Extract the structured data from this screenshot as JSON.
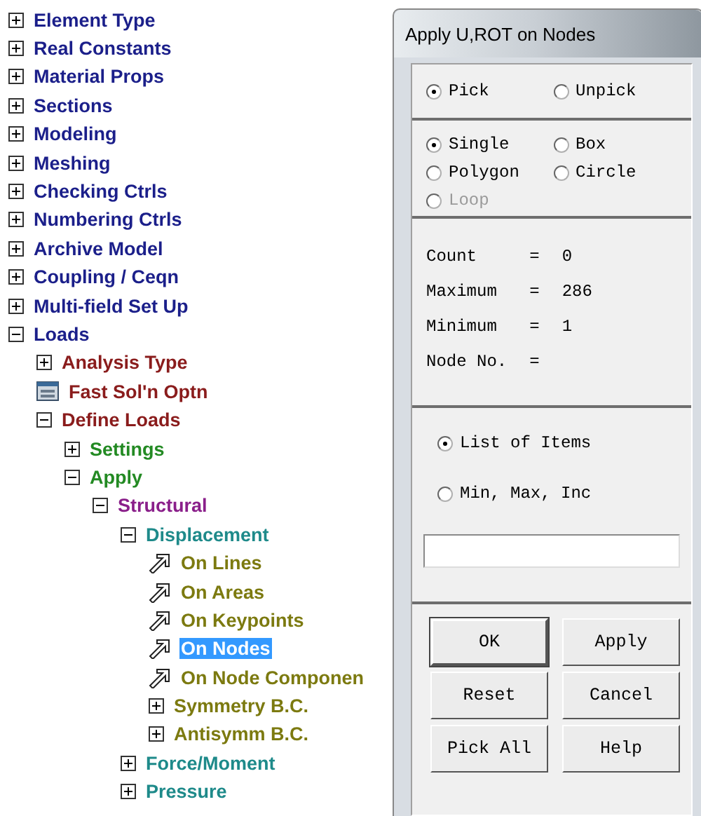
{
  "tree": [
    {
      "kind": "branch",
      "label": "Element Type",
      "expanded": false,
      "selected": false
    },
    {
      "kind": "branch",
      "label": "Real Constants",
      "expanded": false,
      "selected": false
    },
    {
      "kind": "branch",
      "label": "Material Props",
      "expanded": false,
      "selected": false
    },
    {
      "kind": "branch",
      "label": "Sections",
      "expanded": false,
      "selected": false
    },
    {
      "kind": "branch",
      "label": "Modeling",
      "expanded": false,
      "selected": false
    },
    {
      "kind": "branch",
      "label": "Meshing",
      "expanded": false,
      "selected": false
    },
    {
      "kind": "branch",
      "label": "Checking Ctrls",
      "expanded": false,
      "selected": false
    },
    {
      "kind": "branch",
      "label": "Numbering Ctrls",
      "expanded": false,
      "selected": false
    },
    {
      "kind": "branch",
      "label": "Archive Model",
      "expanded": false,
      "selected": false
    },
    {
      "kind": "branch",
      "label": "Coupling / Ceqn",
      "expanded": false,
      "selected": false
    },
    {
      "kind": "branch",
      "label": "Multi-field Set Up",
      "expanded": false,
      "selected": false
    },
    {
      "kind": "branch",
      "label": "Loads",
      "expanded": true,
      "selected": false,
      "children": [
        {
          "kind": "branch",
          "label": "Analysis Type",
          "expanded": false,
          "selected": false
        },
        {
          "kind": "dialog",
          "label": "Fast Sol'n Optn",
          "selected": false
        },
        {
          "kind": "branch",
          "label": "Define Loads",
          "expanded": true,
          "selected": false,
          "children": [
            {
              "kind": "branch",
              "label": "Settings",
              "expanded": false,
              "selected": false
            },
            {
              "kind": "branch",
              "label": "Apply",
              "expanded": true,
              "selected": false,
              "children": [
                {
                  "kind": "branch",
                  "label": "Structural",
                  "expanded": true,
                  "selected": false,
                  "children": [
                    {
                      "kind": "branch",
                      "label": "Displacement",
                      "expanded": true,
                      "selected": false,
                      "children": [
                        {
                          "kind": "action",
                          "label": "On Lines",
                          "selected": false
                        },
                        {
                          "kind": "action",
                          "label": "On Areas",
                          "selected": false
                        },
                        {
                          "kind": "action",
                          "label": "On Keypoints",
                          "selected": false
                        },
                        {
                          "kind": "action",
                          "label": "On Nodes",
                          "selected": true
                        },
                        {
                          "kind": "action",
                          "label": "On Node Componen",
                          "selected": false
                        },
                        {
                          "kind": "branch",
                          "label": "Symmetry B.C.",
                          "expanded": false,
                          "selected": false
                        },
                        {
                          "kind": "branch",
                          "label": "Antisymm B.C.",
                          "expanded": false,
                          "selected": false
                        }
                      ]
                    },
                    {
                      "kind": "branch",
                      "label": "Force/Moment",
                      "expanded": false,
                      "selected": false
                    },
                    {
                      "kind": "branch",
                      "label": "Pressure",
                      "expanded": false,
                      "selected": false
                    }
                  ]
                }
              ]
            }
          ]
        }
      ]
    }
  ],
  "dialog": {
    "title": "Apply U,ROT on Nodes",
    "pick_mode": [
      {
        "label": "Pick",
        "selected": true
      },
      {
        "label": "Unpick",
        "selected": false
      }
    ],
    "pick_shape": [
      {
        "label": "Single",
        "selected": true,
        "disabled": false
      },
      {
        "label": "Box",
        "selected": false,
        "disabled": false
      },
      {
        "label": "Polygon",
        "selected": false,
        "disabled": false
      },
      {
        "label": "Circle",
        "selected": false,
        "disabled": false
      },
      {
        "label": "Loop",
        "selected": false,
        "disabled": true
      }
    ],
    "stats": [
      {
        "label": "Count",
        "sign": "=",
        "value": "0"
      },
      {
        "label": "Maximum",
        "sign": "=",
        "value": "286"
      },
      {
        "label": "Minimum",
        "sign": "=",
        "value": "1"
      },
      {
        "label": "Node No.",
        "sign": "="
      }
    ],
    "input_mode": [
      {
        "label": "List of Items",
        "selected": true
      },
      {
        "label": "Min, Max, Inc",
        "selected": false
      }
    ],
    "buttons": [
      {
        "label": "OK",
        "default": true
      },
      {
        "label": "Apply",
        "default": false
      },
      {
        "label": "Reset",
        "default": false
      },
      {
        "label": "Cancel",
        "default": false
      },
      {
        "label": "Pick All",
        "default": false
      },
      {
        "label": "Help",
        "default": false
      }
    ]
  }
}
